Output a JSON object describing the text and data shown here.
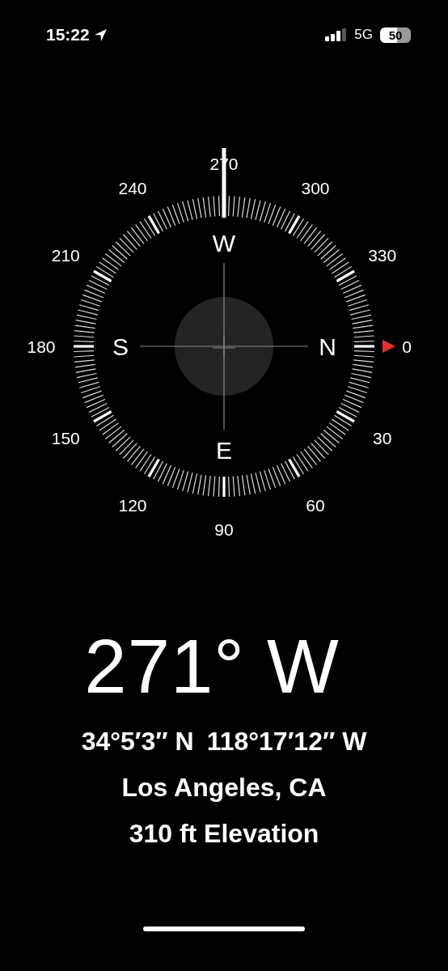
{
  "status_bar": {
    "time": "15:22",
    "network": "5G",
    "battery": "50"
  },
  "dial": {
    "degree_labels": [
      "0",
      "30",
      "60",
      "90",
      "120",
      "150",
      "180",
      "210",
      "240",
      "270",
      "300",
      "330"
    ],
    "cardinals": [
      "N",
      "E",
      "S",
      "W"
    ]
  },
  "heading": "271° W",
  "coordinates": [
    "34°5′3″ N",
    "118°17′12″ W"
  ],
  "location": "Los Angeles, CA",
  "elevation": "310 ft Elevation"
}
